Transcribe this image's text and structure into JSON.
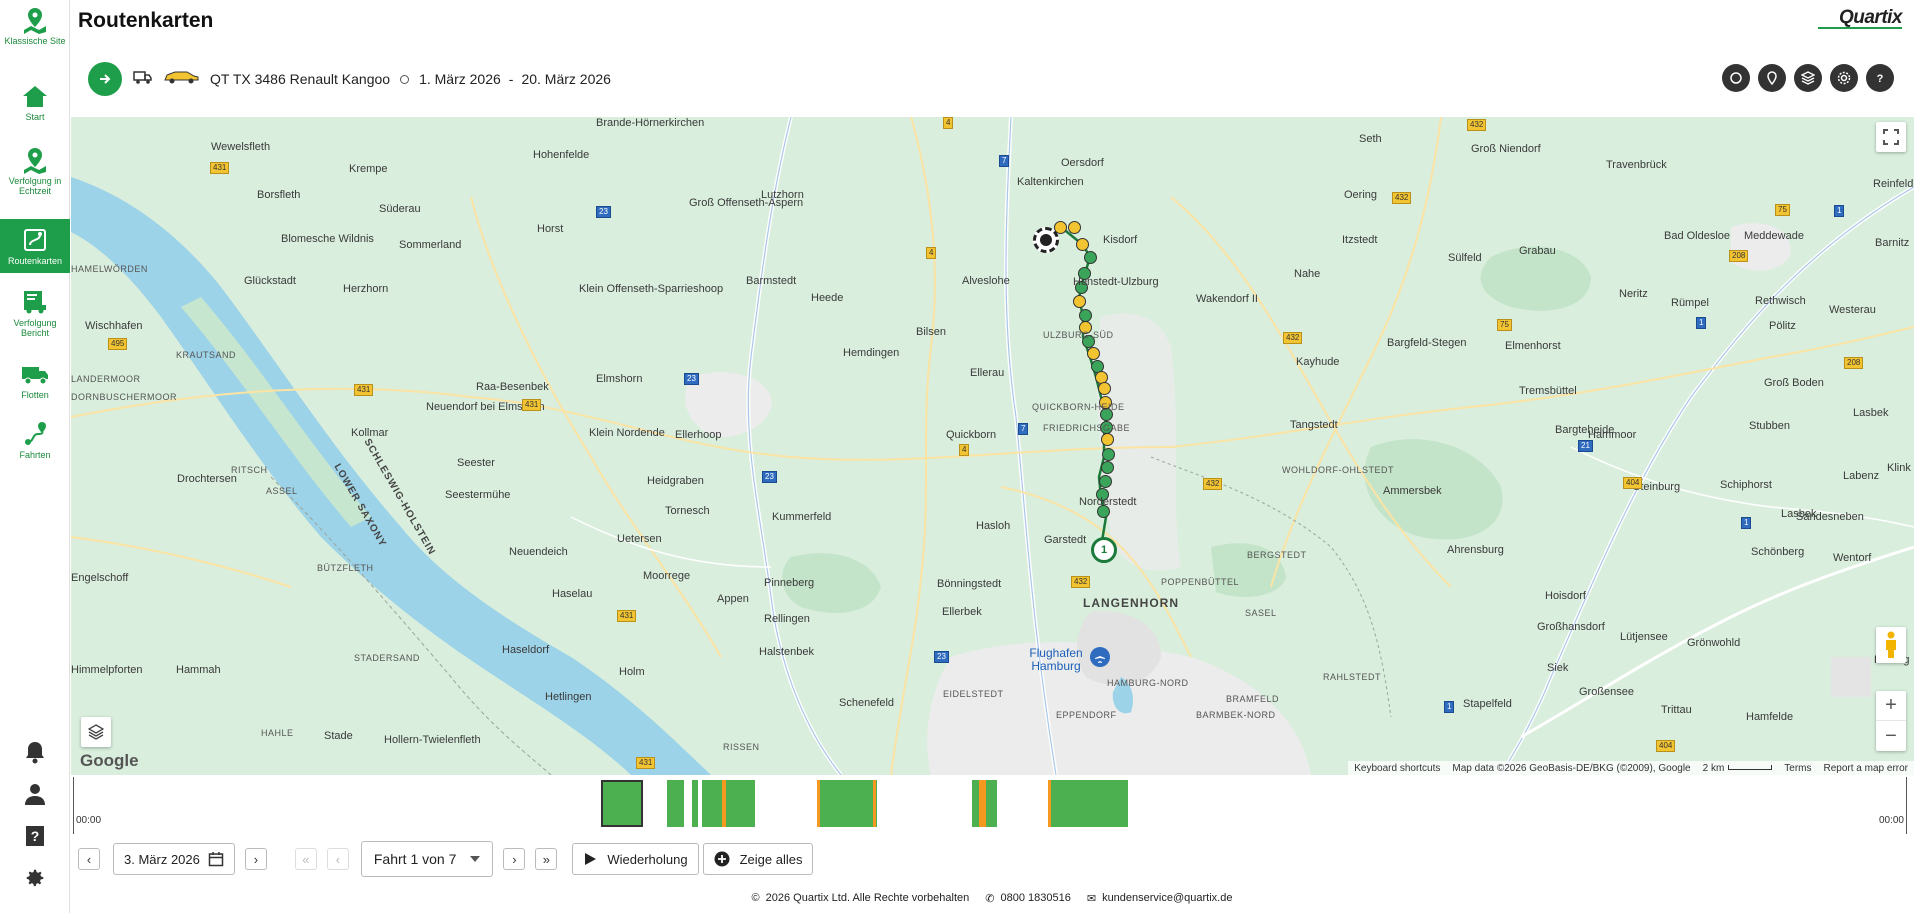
{
  "app": {
    "title": "Routenkarten",
    "brand": "Quartix"
  },
  "sidebar": {
    "items": [
      {
        "label": "Klassische Site",
        "icon": "map-pin-icon"
      },
      {
        "label": "Start",
        "icon": "home-icon"
      },
      {
        "label": "Verfolgung in Echtzeit",
        "icon": "live-map-icon"
      },
      {
        "label": "Routenkarten",
        "icon": "route-map-icon",
        "active": true
      },
      {
        "label": "Verfolgung Bericht",
        "icon": "report-truck-icon"
      },
      {
        "label": "Flotten",
        "icon": "truck-icon"
      },
      {
        "label": "Fahrten",
        "icon": "trips-icon"
      }
    ],
    "bottom_icons": [
      "bell-icon",
      "user-icon",
      "help-book-icon",
      "settings-gear-icon"
    ]
  },
  "toolbar": {
    "vehicle": "QT TX 3486 Renault Kangoo",
    "date_from": "1. März 2026",
    "date_sep": "-",
    "date_to": "20. März 2026",
    "tool_icons": [
      "circle-icon",
      "location-pin-icon",
      "layers-icon",
      "settings-icon",
      "help-icon"
    ]
  },
  "map": {
    "labels": [
      "Brande-Hörnerkirchen",
      "Wewelsfleth",
      "Hohenfelde",
      "Krempe",
      "Lutzhorn",
      "Groß Offenseth-Aspern",
      "Borsfleth",
      "Süderau",
      "Blomesche Wildnis",
      "Sommerland",
      "Horst",
      "Glückstadt",
      "Herzhorn",
      "Klein Offenseth-Sparrieshoop",
      "Barmstedt",
      "Heede",
      "Alveslohe",
      "Kaltenkirchen",
      "Oersdorf",
      "Kisdorf",
      "Henstedt-Ulzburg",
      "Wakendorf II",
      "Nahe",
      "Itzstedt",
      "Seth",
      "Groß Niendorf",
      "Travenbrück",
      "Oering",
      "Sülfeld",
      "Grabau",
      "Bad Oldesloe",
      "Meddewade",
      "Reinfeld",
      "Barnitz",
      "Neritz",
      "Rümpel",
      "Rethwisch",
      "Westerau",
      "Pölitz",
      "Wischhafen",
      "Bilsen",
      "Hemdingen",
      "Ellerau",
      "Kayhude",
      "Bargfeld-Stegen",
      "Elmenhorst",
      "Tremsbüttel",
      "Groß Boden",
      "Lasbek",
      "Stubben",
      "Raa-Besenbek",
      "Neuendorf bei Elmshorn",
      "Kollmar",
      "Elmshorn",
      "Klein Nordende",
      "Ellerhoop",
      "Quickborn",
      "Tangstedt",
      "Bargteheide",
      "Hammoor",
      "Steinburg",
      "Schiphorst",
      "Sandesneben",
      "Seester",
      "Seestermühe",
      "Heidgraben",
      "Tornesch",
      "Drochtersen",
      "Uetersen",
      "Kummerfeld",
      "Hasloh",
      "Norderstedt",
      "Ammersbek",
      "Ahrensburg",
      "Schönberg",
      "Wentorf",
      "Neuendeich",
      "Moorrege",
      "Pinneberg",
      "Bönningstedt",
      "Engelschoff",
      "Haselau",
      "Appen",
      "Rellingen",
      "Ellerbek",
      "Hoisdorf",
      "Großhansdorf",
      "Lütjensee",
      "Grönwohld",
      "Haseldorf",
      "Halstenbek",
      "Siek",
      "Hammah",
      "Holm",
      "Himmelpforten",
      "Hetlingen",
      "Schenefeld",
      "Großensee",
      "Trittau",
      "Stapelfeld",
      "Hamfelde",
      "Stade",
      "Hollern-Twielenfleth",
      "Lasbek",
      "Klink",
      "Labenz",
      "Koberg",
      "Garstedt"
    ],
    "district_labels": [
      "HAMELWÖRDEN",
      "KRAUTSAND",
      "LANDERMOOR",
      "DORNBUSCHERMOOR",
      "RITSCH",
      "ASSEL",
      "BÜTZFLETH",
      "STADERSAND",
      "HAHLE",
      "ULZBURG-SÜD",
      "QUICKBORN-HEIDE",
      "FRIEDRICHSGABE",
      "WOHLDORF-OHLSTEDT",
      "POPPENBÜTTEL",
      "SASEL",
      "BERGSTEDT",
      "LANGENHORN",
      "HAMBURG-NORD",
      "BRAMFELD",
      "RAHLSTEDT",
      "EIDELSTEDT",
      "EPPENDORF",
      "BARMBEK-NORD",
      "RISSEN",
      "SCHLESWIG-HOLSTEIN",
      "LOWER SAXONY"
    ],
    "airport": "Flughafen Hamburg",
    "attribution": {
      "shortcuts": "Keyboard shortcuts",
      "data": "Map data ©2026 GeoBasis-DE/BKG (©2009), Google",
      "scale": "2 km",
      "terms": "Terms",
      "report": "Report a map error"
    },
    "google": "Google",
    "start_marker": "1"
  },
  "timeline": {
    "start": "00:00",
    "end": "00:00"
  },
  "controls": {
    "date": "3. März 2026",
    "trip": "Fahrt 1 von 7",
    "replay": "Wiederholung",
    "show_all": "Zeige alles"
  },
  "footer": {
    "copyright": "2026 Quartix Ltd. Alle Rechte vorbehalten",
    "phone": "0800 1830516",
    "email": "kundenservice@quartix.de"
  },
  "colors": {
    "accent": "#1e9e4a",
    "trip": "#4caf50",
    "stop": "#f5981f"
  }
}
